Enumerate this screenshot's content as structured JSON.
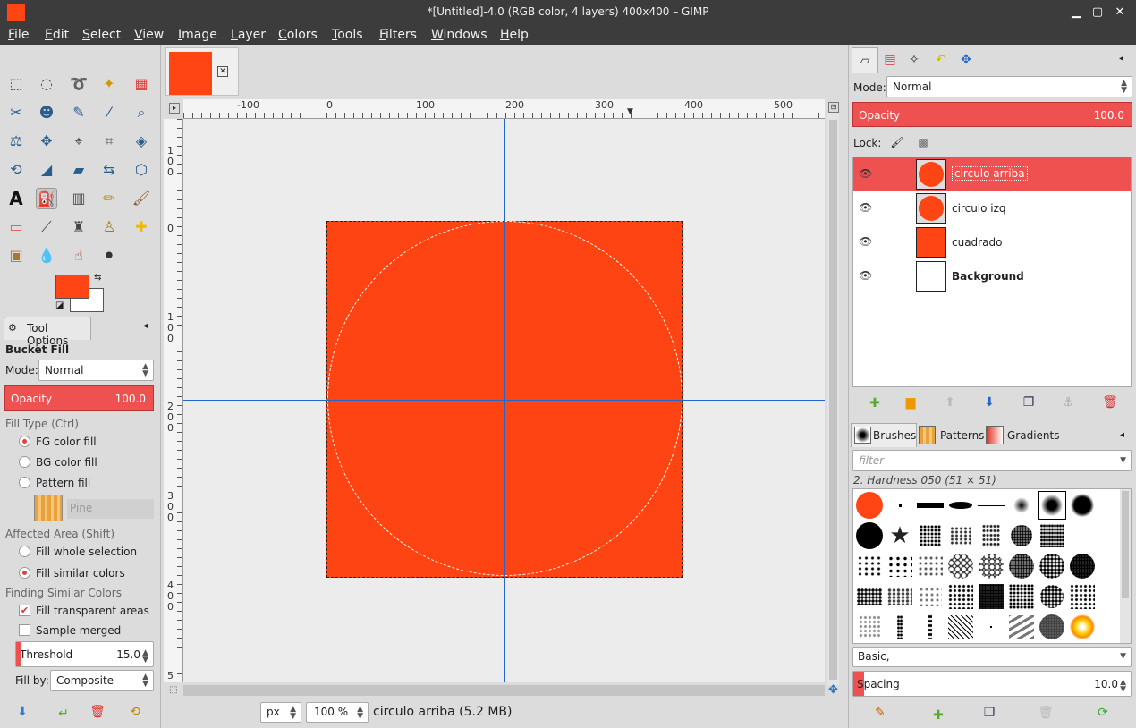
{
  "window": {
    "title": "*[Untitled]-4.0 (RGB color, 4 layers) 400x400 – GIMP",
    "minimize": "▁",
    "maximize": "▢",
    "close": "✕"
  },
  "menu": [
    "File",
    "Edit",
    "Select",
    "View",
    "Image",
    "Layer",
    "Colors",
    "Tools",
    "Filters",
    "Windows",
    "Help"
  ],
  "toolbox": {
    "icons": [
      "rect-select",
      "ellipse-select",
      "free-select",
      "fuzzy-select",
      "color-select",
      "scissors-select",
      "foreground-select",
      "paths",
      "color-picker",
      "zoom",
      "measure",
      "move",
      "align",
      "crop",
      "unified-transform",
      "rotate",
      "scale",
      "shear",
      "flip",
      "cage",
      "text",
      "bucket-fill",
      "blend",
      "pencil",
      "paintbrush",
      "eraser",
      "airbrush",
      "ink",
      "clone",
      "heal",
      "perspective-clone",
      "smudge",
      "dodge-burn",
      "blur"
    ],
    "fg_color": "#ff4513",
    "bg_color": "#ffffff"
  },
  "tool_options": {
    "tab": "Tool Options",
    "tool": "Bucket Fill",
    "mode_label": "Mode:",
    "mode": "Normal",
    "opacity_label": "Opacity",
    "opacity": "100.0",
    "fill_type": "Fill Type  (Ctrl)",
    "fill_options": [
      "FG color fill",
      "BG color fill",
      "Pattern fill"
    ],
    "pattern": "Pine",
    "affected": "Affected Area  (Shift)",
    "affected_options": [
      "Fill whole selection",
      "Fill similar colors"
    ],
    "finding": "Finding Similar Colors",
    "fill_transparent": "Fill transparent areas",
    "sample_merged": "Sample merged",
    "threshold_label": "Threshold",
    "threshold": "15.0",
    "fillby_label": "Fill by:",
    "fillby": "Composite"
  },
  "canvas": {
    "hruler": [
      "-100",
      "0",
      "100",
      "200",
      "300",
      "400",
      "500"
    ],
    "vruler": [
      "1\n0\n0",
      "0",
      "1\n0\n0",
      "2\n0\n0",
      "3\n0\n0",
      "4\n0\n0",
      "5"
    ],
    "fill_color": "#fd4412",
    "unit": "px",
    "zoom": "100 %",
    "status": "circulo arriba (5.2 MB)"
  },
  "layers_panel": {
    "mode_label": "Mode:",
    "mode": "Normal",
    "opacity_label": "Opacity",
    "opacity": "100.0",
    "lock_label": "Lock:",
    "layers": [
      {
        "name": "circulo arriba",
        "selected": true
      },
      {
        "name": "circulo izq"
      },
      {
        "name": "cuadrado"
      },
      {
        "name": "Background"
      }
    ]
  },
  "brushes_panel": {
    "tabs": [
      "Brushes",
      "Patterns",
      "Gradients"
    ],
    "filter_placeholder": "filter",
    "current": "2. Hardness 050 (51 × 51)",
    "preset": "Basic,",
    "spacing_label": "Spacing",
    "spacing": "10.0"
  }
}
